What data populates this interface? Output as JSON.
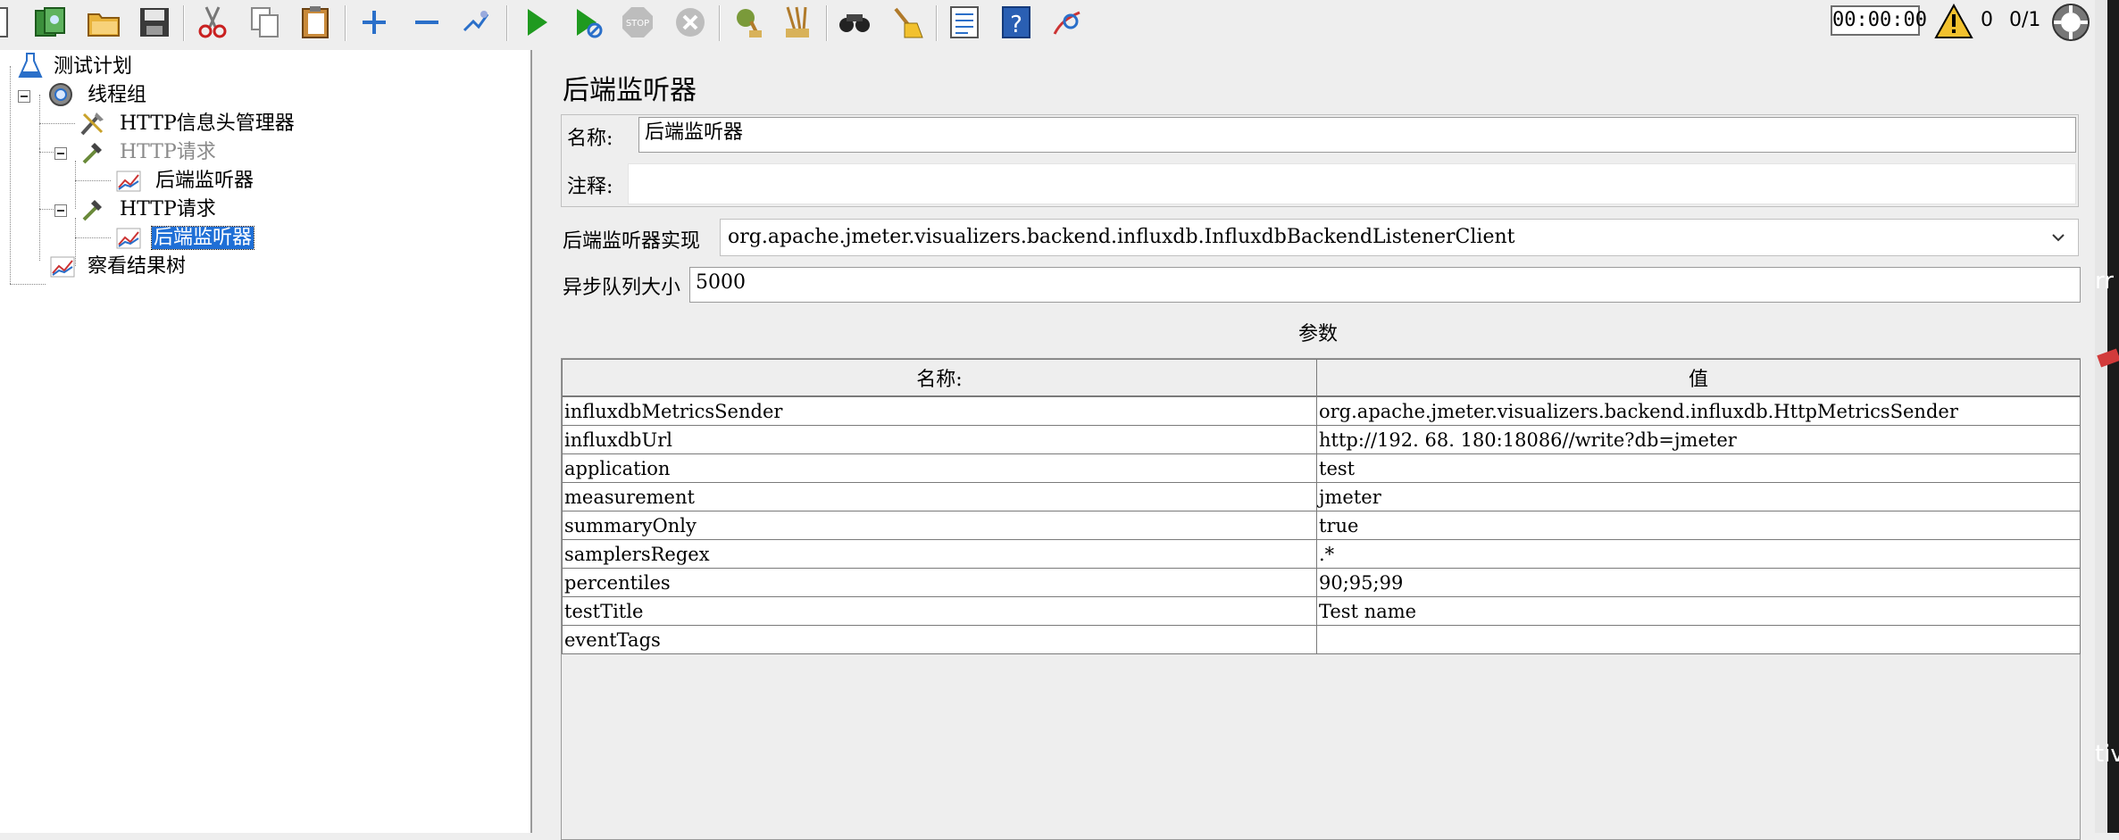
{
  "toolbar": {
    "buttons": [
      "new-icon",
      "templates-icon",
      "open-icon",
      "save-icon",
      "cut-icon",
      "copy-icon",
      "paste-icon",
      "expand-icon",
      "collapse-icon",
      "toggle-icon",
      "start-icon",
      "start-no-pause-icon",
      "stop-icon",
      "shutdown-icon",
      "clear-icon",
      "clear-all-icon",
      "search-icon",
      "reset-search-icon",
      "function-helper-icon",
      "help-icon",
      "remote-icon"
    ],
    "timer": "00:00:00",
    "warning_count": "0",
    "threads": "0/1"
  },
  "tree": {
    "items": [
      {
        "label": "测试计划"
      },
      {
        "label": "线程组"
      },
      {
        "label": "HTTP信息头管理器"
      },
      {
        "label": "HTTP请求"
      },
      {
        "label": "后端监听器"
      },
      {
        "label": "HTTP请求"
      },
      {
        "label": "后端监听器"
      },
      {
        "label": "察看结果树"
      }
    ]
  },
  "editor": {
    "title": "后端监听器",
    "name_label": "名称:",
    "name_value": "后端监听器",
    "comment_label": "注释:",
    "comment_value": "",
    "impl_label": "后端监听器实现",
    "impl_value": "org.apache.jmeter.visualizers.backend.influxdb.InfluxdbBackendListenerClient",
    "queue_label": "异步队列大小",
    "queue_value": "5000",
    "params_title": "参数",
    "columns": [
      "名称:",
      "值"
    ],
    "rows": [
      [
        "influxdbMetricsSender",
        "org.apache.jmeter.visualizers.backend.influxdb.HttpMetricsSender"
      ],
      [
        "influxdbUrl",
        "http://192.   68.    180:18086//write?db=jmeter"
      ],
      [
        "application",
        "test"
      ],
      [
        "measurement",
        "jmeter"
      ],
      [
        "summaryOnly",
        "true"
      ],
      [
        "samplersRegex",
        ".*"
      ],
      [
        "percentiles",
        "90;95;99"
      ],
      [
        "testTitle",
        "Test name"
      ],
      [
        "eventTags",
        ""
      ]
    ]
  },
  "edge": {
    "top_text": "rr",
    "bottom_text": "tiv"
  },
  "colors": {
    "selection": "#1f6fd6",
    "run_green": "#1f9a1f",
    "accent_blue": "#2a6fc9"
  }
}
